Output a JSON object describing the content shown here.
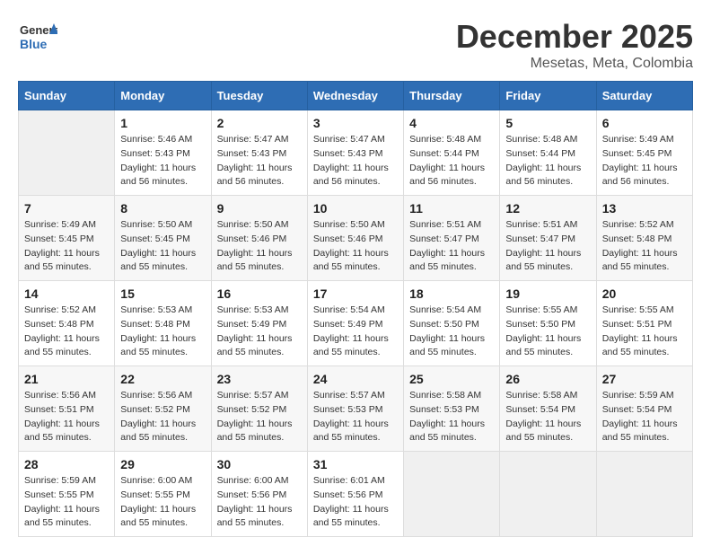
{
  "header": {
    "logo_line1": "General",
    "logo_line2": "Blue",
    "month": "December 2025",
    "location": "Mesetas, Meta, Colombia"
  },
  "days_of_week": [
    "Sunday",
    "Monday",
    "Tuesday",
    "Wednesday",
    "Thursday",
    "Friday",
    "Saturday"
  ],
  "weeks": [
    [
      {
        "day": "",
        "info": ""
      },
      {
        "day": "1",
        "info": "Sunrise: 5:46 AM\nSunset: 5:43 PM\nDaylight: 11 hours\nand 56 minutes."
      },
      {
        "day": "2",
        "info": "Sunrise: 5:47 AM\nSunset: 5:43 PM\nDaylight: 11 hours\nand 56 minutes."
      },
      {
        "day": "3",
        "info": "Sunrise: 5:47 AM\nSunset: 5:43 PM\nDaylight: 11 hours\nand 56 minutes."
      },
      {
        "day": "4",
        "info": "Sunrise: 5:48 AM\nSunset: 5:44 PM\nDaylight: 11 hours\nand 56 minutes."
      },
      {
        "day": "5",
        "info": "Sunrise: 5:48 AM\nSunset: 5:44 PM\nDaylight: 11 hours\nand 56 minutes."
      },
      {
        "day": "6",
        "info": "Sunrise: 5:49 AM\nSunset: 5:45 PM\nDaylight: 11 hours\nand 56 minutes."
      }
    ],
    [
      {
        "day": "7",
        "info": "Sunrise: 5:49 AM\nSunset: 5:45 PM\nDaylight: 11 hours\nand 55 minutes."
      },
      {
        "day": "8",
        "info": "Sunrise: 5:50 AM\nSunset: 5:45 PM\nDaylight: 11 hours\nand 55 minutes."
      },
      {
        "day": "9",
        "info": "Sunrise: 5:50 AM\nSunset: 5:46 PM\nDaylight: 11 hours\nand 55 minutes."
      },
      {
        "day": "10",
        "info": "Sunrise: 5:50 AM\nSunset: 5:46 PM\nDaylight: 11 hours\nand 55 minutes."
      },
      {
        "day": "11",
        "info": "Sunrise: 5:51 AM\nSunset: 5:47 PM\nDaylight: 11 hours\nand 55 minutes."
      },
      {
        "day": "12",
        "info": "Sunrise: 5:51 AM\nSunset: 5:47 PM\nDaylight: 11 hours\nand 55 minutes."
      },
      {
        "day": "13",
        "info": "Sunrise: 5:52 AM\nSunset: 5:48 PM\nDaylight: 11 hours\nand 55 minutes."
      }
    ],
    [
      {
        "day": "14",
        "info": "Sunrise: 5:52 AM\nSunset: 5:48 PM\nDaylight: 11 hours\nand 55 minutes."
      },
      {
        "day": "15",
        "info": "Sunrise: 5:53 AM\nSunset: 5:48 PM\nDaylight: 11 hours\nand 55 minutes."
      },
      {
        "day": "16",
        "info": "Sunrise: 5:53 AM\nSunset: 5:49 PM\nDaylight: 11 hours\nand 55 minutes."
      },
      {
        "day": "17",
        "info": "Sunrise: 5:54 AM\nSunset: 5:49 PM\nDaylight: 11 hours\nand 55 minutes."
      },
      {
        "day": "18",
        "info": "Sunrise: 5:54 AM\nSunset: 5:50 PM\nDaylight: 11 hours\nand 55 minutes."
      },
      {
        "day": "19",
        "info": "Sunrise: 5:55 AM\nSunset: 5:50 PM\nDaylight: 11 hours\nand 55 minutes."
      },
      {
        "day": "20",
        "info": "Sunrise: 5:55 AM\nSunset: 5:51 PM\nDaylight: 11 hours\nand 55 minutes."
      }
    ],
    [
      {
        "day": "21",
        "info": "Sunrise: 5:56 AM\nSunset: 5:51 PM\nDaylight: 11 hours\nand 55 minutes."
      },
      {
        "day": "22",
        "info": "Sunrise: 5:56 AM\nSunset: 5:52 PM\nDaylight: 11 hours\nand 55 minutes."
      },
      {
        "day": "23",
        "info": "Sunrise: 5:57 AM\nSunset: 5:52 PM\nDaylight: 11 hours\nand 55 minutes."
      },
      {
        "day": "24",
        "info": "Sunrise: 5:57 AM\nSunset: 5:53 PM\nDaylight: 11 hours\nand 55 minutes."
      },
      {
        "day": "25",
        "info": "Sunrise: 5:58 AM\nSunset: 5:53 PM\nDaylight: 11 hours\nand 55 minutes."
      },
      {
        "day": "26",
        "info": "Sunrise: 5:58 AM\nSunset: 5:54 PM\nDaylight: 11 hours\nand 55 minutes."
      },
      {
        "day": "27",
        "info": "Sunrise: 5:59 AM\nSunset: 5:54 PM\nDaylight: 11 hours\nand 55 minutes."
      }
    ],
    [
      {
        "day": "28",
        "info": "Sunrise: 5:59 AM\nSunset: 5:55 PM\nDaylight: 11 hours\nand 55 minutes."
      },
      {
        "day": "29",
        "info": "Sunrise: 6:00 AM\nSunset: 5:55 PM\nDaylight: 11 hours\nand 55 minutes."
      },
      {
        "day": "30",
        "info": "Sunrise: 6:00 AM\nSunset: 5:56 PM\nDaylight: 11 hours\nand 55 minutes."
      },
      {
        "day": "31",
        "info": "Sunrise: 6:01 AM\nSunset: 5:56 PM\nDaylight: 11 hours\nand 55 minutes."
      },
      {
        "day": "",
        "info": ""
      },
      {
        "day": "",
        "info": ""
      },
      {
        "day": "",
        "info": ""
      }
    ]
  ]
}
